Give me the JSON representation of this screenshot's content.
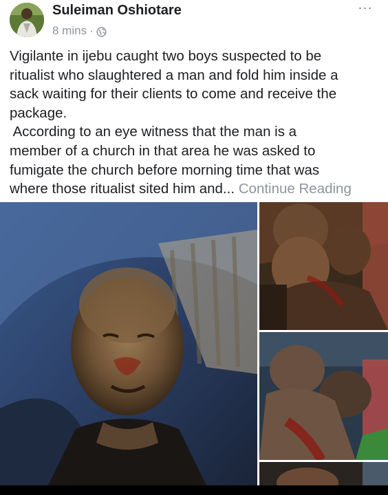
{
  "post": {
    "author": "Suleiman Oshiotare",
    "timestamp": "8 mins",
    "separator": "·",
    "privacy_icon": "globe-icon",
    "more_label": "···",
    "text_lines": [
      "Vigilante in ijebu caught two boys suspected to be",
      "ritualist who slaughtered a man and fold him inside a",
      "sack waiting for their clients to come and receive the",
      "package.",
      " According to an eye witness that the man is a",
      "member of a church in that area he was asked to",
      "fumigate the church before morning time that was"
    ],
    "last_line": "where those ritualist sited him and...",
    "continue_label": "Continue Reading"
  },
  "colors": {
    "text": "#1c1e21",
    "meta": "#8d949e",
    "background": "#ffffff"
  }
}
